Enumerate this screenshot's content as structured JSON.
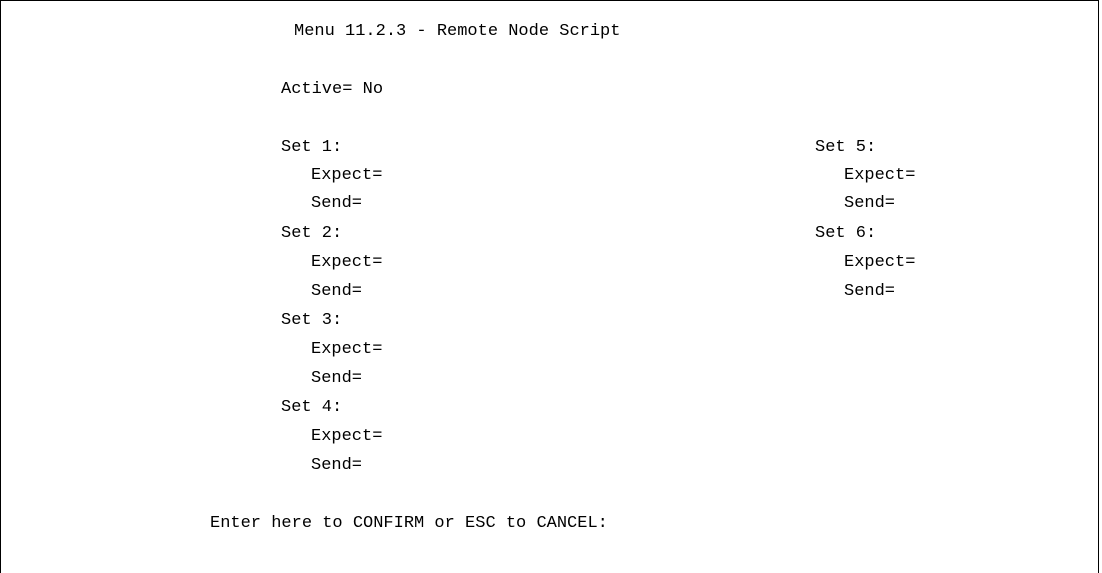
{
  "title": "Menu 11.2.3 - Remote Node Script",
  "active": {
    "label": "Active=",
    "value": "No"
  },
  "sets": [
    {
      "label": "Set 1:",
      "expect_label": "Expect=",
      "expect_value": "",
      "send_label": "Send=",
      "send_value": ""
    },
    {
      "label": "Set 2:",
      "expect_label": "Expect=",
      "expect_value": "",
      "send_label": "Send=",
      "send_value": ""
    },
    {
      "label": "Set 3:",
      "expect_label": "Expect=",
      "expect_value": "",
      "send_label": "Send=",
      "send_value": ""
    },
    {
      "label": "Set 4:",
      "expect_label": "Expect=",
      "expect_value": "",
      "send_label": "Send=",
      "send_value": ""
    },
    {
      "label": "Set 5:",
      "expect_label": "Expect=",
      "expect_value": "",
      "send_label": "Send=",
      "send_value": ""
    },
    {
      "label": "Set 6:",
      "expect_label": "Expect=",
      "expect_value": "",
      "send_label": "Send=",
      "send_value": ""
    }
  ],
  "prompt": "Enter here to CONFIRM or ESC to CANCEL:"
}
